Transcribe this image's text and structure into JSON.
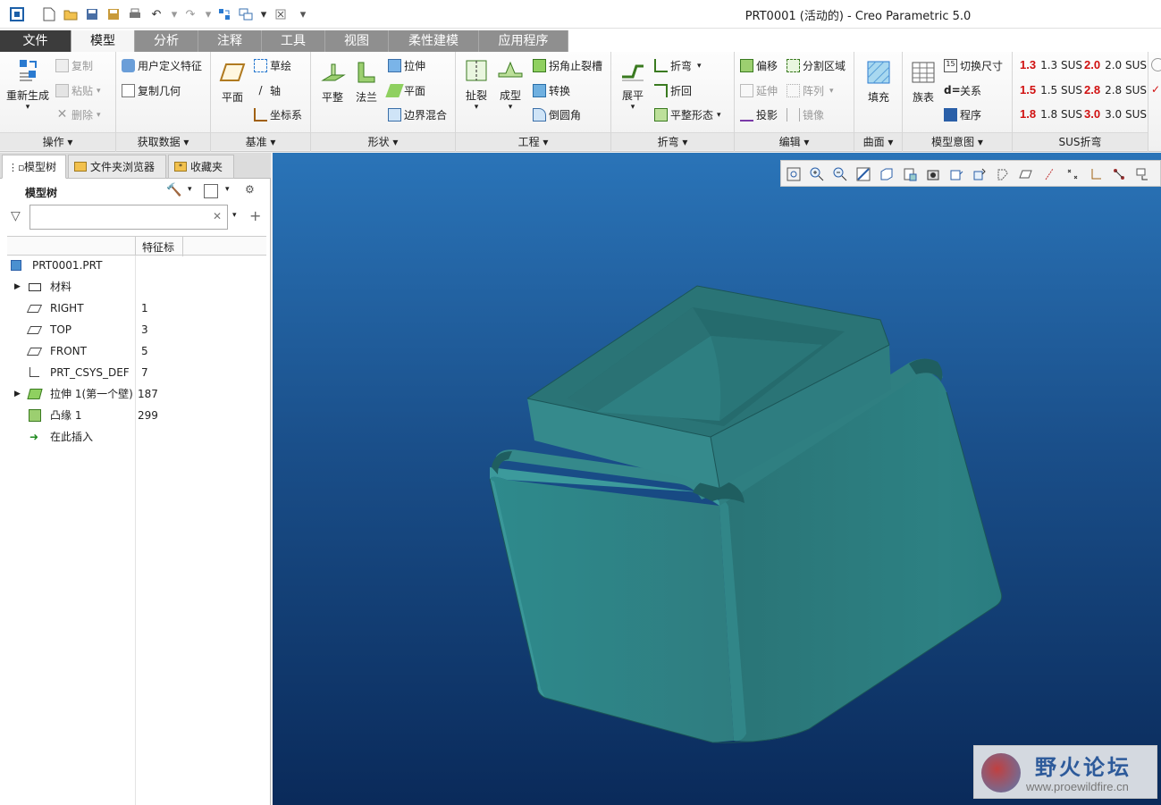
{
  "window": {
    "title": "PRT0001 (活动的) - Creo Parametric 5.0"
  },
  "tabs": [
    "文件",
    "模型",
    "分析",
    "注释",
    "工具",
    "视图",
    "柔性建模",
    "应用程序"
  ],
  "active_tab": "模型",
  "ribbon": {
    "ops": {
      "regen": "重新生成",
      "copy": "复制",
      "paste": "粘贴",
      "delete": "删除",
      "label": "操作"
    },
    "getdata": {
      "udf": "用户定义特征",
      "copygeom": "复制几何",
      "label": "获取数据"
    },
    "datum": {
      "plane": "平面",
      "sketch": "草绘",
      "axis": "轴",
      "csys": "坐标系",
      "label": "基准"
    },
    "shapes": {
      "flatten": "平整",
      "flange": "法兰",
      "extrude": "拉伸",
      "planar": "平面",
      "blend": "边界混合",
      "label": "形状"
    },
    "eng": {
      "rip": "扯裂",
      "form": "成型",
      "cornerrelief": "拐角止裂槽",
      "convert": "转换",
      "round": "倒圆角",
      "label": "工程"
    },
    "bend": {
      "unbend": "展平",
      "bend": "折弯",
      "bendback": "折回",
      "flatform": "平整形态",
      "label": "折弯"
    },
    "edit": {
      "offset": "偏移",
      "extend": "延伸",
      "project": "投影",
      "split": "分割区域",
      "pattern": "阵列",
      "mirror": "镜像",
      "label": "编辑"
    },
    "surface": {
      "fill": "填充",
      "label": "曲面"
    },
    "intent": {
      "family": "族表",
      "switchdim": "切换尺寸",
      "relations": "关系",
      "program": "程序",
      "label": "模型意图"
    },
    "sus": {
      "label": "SUS折弯",
      "items": [
        {
          "icon": "1.3",
          "text": "1.3 SUS"
        },
        {
          "icon": "2.0",
          "text": "2.0 SUS"
        },
        {
          "icon": "1.5",
          "text": "1.5 SUS"
        },
        {
          "icon": "2.8",
          "text": "2.8 SUS"
        },
        {
          "icon": "1.8",
          "text": "1.8 SUS"
        },
        {
          "icon": "3.0",
          "text": "3.0 SUS"
        }
      ]
    }
  },
  "panel": {
    "tabs": [
      "模型树",
      "文件夹浏览器",
      "收藏夹"
    ],
    "tree_title": "模型树",
    "filter_placeholder": "",
    "col_header": "特征标",
    "rows": [
      {
        "label": "PRT0001.PRT",
        "id": ""
      },
      {
        "label": "材料",
        "id": ""
      },
      {
        "label": "RIGHT",
        "id": "1"
      },
      {
        "label": "TOP",
        "id": "3"
      },
      {
        "label": "FRONT",
        "id": "5"
      },
      {
        "label": "PRT_CSYS_DEF",
        "id": "7"
      },
      {
        "label": "拉伸 1(第一个壁)",
        "id": "187"
      },
      {
        "label": "凸缘 1",
        "id": "299"
      },
      {
        "label": "在此插入",
        "id": ""
      }
    ]
  },
  "watermark": {
    "title": "野火论坛",
    "url": "www.proewildfire.cn"
  }
}
